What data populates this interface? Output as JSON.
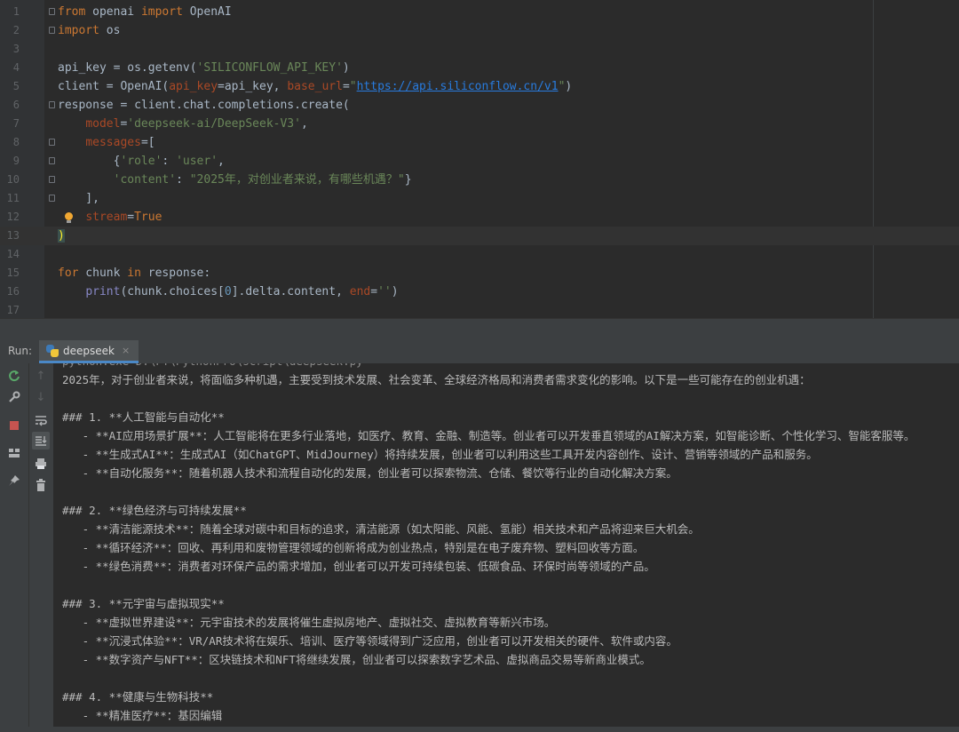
{
  "editor": {
    "lines": [
      {
        "n": "1",
        "parts": [
          {
            "t": "from",
            "c": "kw"
          },
          {
            "t": " openai "
          },
          {
            "t": "import",
            "c": "kw"
          },
          {
            "t": " OpenAI"
          }
        ]
      },
      {
        "n": "2",
        "parts": [
          {
            "t": "import",
            "c": "kw"
          },
          {
            "t": " os"
          }
        ]
      },
      {
        "n": "3",
        "parts": []
      },
      {
        "n": "4",
        "parts": [
          {
            "t": "api_key = os.getenv("
          },
          {
            "t": "'SILICONFLOW_API_KEY'",
            "c": "str"
          },
          {
            "t": ")"
          }
        ]
      },
      {
        "n": "5",
        "parts": [
          {
            "t": "client = OpenAI("
          },
          {
            "t": "api_key",
            "c": "param"
          },
          {
            "t": "=api_key, "
          },
          {
            "t": "base_url",
            "c": "param"
          },
          {
            "t": "="
          },
          {
            "t": "\"",
            "c": "str"
          },
          {
            "t": "https://api.siliconflow.cn/v1",
            "c": "url"
          },
          {
            "t": "\"",
            "c": "str"
          },
          {
            "t": ")"
          }
        ]
      },
      {
        "n": "6",
        "parts": [
          {
            "t": "response = client.chat.completions.create("
          }
        ]
      },
      {
        "n": "7",
        "parts": [
          {
            "t": "    "
          },
          {
            "t": "model",
            "c": "param"
          },
          {
            "t": "="
          },
          {
            "t": "'deepseek-ai/DeepSeek-V3'",
            "c": "str"
          },
          {
            "t": ","
          }
        ]
      },
      {
        "n": "8",
        "parts": [
          {
            "t": "    "
          },
          {
            "t": "messages",
            "c": "param"
          },
          {
            "t": "=["
          }
        ]
      },
      {
        "n": "9",
        "parts": [
          {
            "t": "        {"
          },
          {
            "t": "'role'",
            "c": "str"
          },
          {
            "t": ": "
          },
          {
            "t": "'user'",
            "c": "str"
          },
          {
            "t": ","
          }
        ]
      },
      {
        "n": "10",
        "parts": [
          {
            "t": "        "
          },
          {
            "t": "'content'",
            "c": "str"
          },
          {
            "t": ": "
          },
          {
            "t": "\"2025年，对创业者来说，有哪些机遇？\"",
            "c": "str"
          },
          {
            "t": "}"
          }
        ]
      },
      {
        "n": "11",
        "parts": [
          {
            "t": "    ],"
          }
        ]
      },
      {
        "n": "12",
        "parts": [
          {
            "t": "    "
          },
          {
            "t": "stream",
            "c": "param"
          },
          {
            "t": "="
          },
          {
            "t": "True",
            "c": "kw"
          }
        ]
      },
      {
        "n": "13",
        "parts": [
          {
            "t": ")",
            "c": "bracket-hl"
          }
        ]
      },
      {
        "n": "14",
        "parts": []
      },
      {
        "n": "15",
        "parts": [
          {
            "t": "for",
            "c": "kw"
          },
          {
            "t": " chunk "
          },
          {
            "t": "in",
            "c": "kw"
          },
          {
            "t": " response:"
          }
        ]
      },
      {
        "n": "16",
        "parts": [
          {
            "t": "    "
          },
          {
            "t": "print",
            "c": "builtin"
          },
          {
            "t": "(chunk.choices["
          },
          {
            "t": "0",
            "c": "num"
          },
          {
            "t": "].delta.content, "
          },
          {
            "t": "end",
            "c": "param"
          },
          {
            "t": "="
          },
          {
            "t": "''",
            "c": "str"
          },
          {
            "t": ")"
          }
        ]
      },
      {
        "n": "17",
        "parts": []
      }
    ]
  },
  "run": {
    "label": "Run:",
    "tab_name": "deepseek",
    "tab_close": "×"
  },
  "console": {
    "lines": [
      "python.exe D:\\PY\\PythonPro\\script\\deepseek.py",
      "2025年，对于创业者来说，将面临多种机遇，主要受到技术发展、社会变革、全球经济格局和消费者需求变化的影响。以下是一些可能存在的创业机遇：",
      "",
      "### 1. **人工智能与自动化**",
      "   - **AI应用场景扩展**：人工智能将在更多行业落地，如医疗、教育、金融、制造等。创业者可以开发垂直领域的AI解决方案，如智能诊断、个性化学习、智能客服等。",
      "   - **生成式AI**：生成式AI（如ChatGPT、MidJourney）将持续发展，创业者可以利用这些工具开发内容创作、设计、营销等领域的产品和服务。",
      "   - **自动化服务**：随着机器人技术和流程自动化的发展，创业者可以探索物流、仓储、餐饮等行业的自动化解决方案。",
      "",
      "### 2. **绿色经济与可持续发展**",
      "   - **清洁能源技术**：随着全球对碳中和目标的追求，清洁能源（如太阳能、风能、氢能）相关技术和产品将迎来巨大机会。",
      "   - **循环经济**：回收、再利用和废物管理领域的创新将成为创业热点，特别是在电子废弃物、塑料回收等方面。",
      "   - **绿色消费**：消费者对环保产品的需求增加，创业者可以开发可持续包装、低碳食品、环保时尚等领域的产品。",
      "",
      "### 3. **元宇宙与虚拟现实**",
      "   - **虚拟世界建设**：元宇宙技术的发展将催生虚拟房地产、虚拟社交、虚拟教育等新兴市场。",
      "   - **沉浸式体验**：VR/AR技术将在娱乐、培训、医疗等领域得到广泛应用，创业者可以开发相关的硬件、软件或内容。",
      "   - **数字资产与NFT**：区块链技术和NFT将继续发展，创业者可以探索数字艺术品、虚拟商品交易等新商业模式。",
      "",
      "### 4. **健康与生物科技**",
      "   - **精准医疗**：基因编辑"
    ]
  },
  "colors": {
    "editor_bg": "#2b2b2b",
    "gutter_bg": "#313335",
    "panel_bg": "#3c3f41",
    "keyword": "#cc7832",
    "string": "#6a8759",
    "param": "#aa4926",
    "link": "#287bde",
    "tab_underline": "#4a88c7"
  },
  "icons": {
    "toolbar_left": [
      "rerun-icon",
      "wrench-icon",
      "stop-icon",
      "layout-icon",
      "pin-icon"
    ],
    "toolbar_second": [
      "up-arrow-icon",
      "down-arrow-icon",
      "soft-wrap-icon",
      "scroll-to-end-icon",
      "print-icon",
      "trash-icon"
    ]
  }
}
